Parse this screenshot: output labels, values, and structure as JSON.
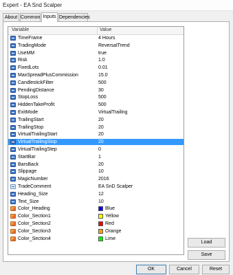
{
  "window": {
    "title": "Expert - EA Snd Scalper"
  },
  "tabs": [
    {
      "label": "About"
    },
    {
      "label": "Common"
    },
    {
      "label": "Inputs"
    },
    {
      "label": "Dependencies"
    }
  ],
  "grid": {
    "col_variable": "Variable",
    "col_value": "Value",
    "rows": [
      {
        "icon": "number-icon",
        "name": "TimeFrame",
        "value": "4 Hours"
      },
      {
        "icon": "number-icon",
        "name": "TradingMode",
        "value": "ReversalTrend"
      },
      {
        "icon": "number-icon",
        "name": "UseMM",
        "value": "true"
      },
      {
        "icon": "number-icon",
        "name": "Risk",
        "value": "1.0"
      },
      {
        "icon": "number-icon",
        "name": "FixedLots",
        "value": "0.01"
      },
      {
        "icon": "number-icon",
        "name": "MaxSpreadPlusCommission",
        "value": "15.0"
      },
      {
        "icon": "number-icon",
        "name": "CandlestickFilter",
        "value": "500"
      },
      {
        "icon": "number-icon",
        "name": "PendingDistance",
        "value": "30"
      },
      {
        "icon": "number-icon",
        "name": "StopLoss",
        "value": "500"
      },
      {
        "icon": "number-icon",
        "name": "HiddenTakeProfit",
        "value": "500"
      },
      {
        "icon": "number-icon",
        "name": "ExitMode",
        "value": "VirtualTrailing"
      },
      {
        "icon": "number-icon",
        "name": "TrailingStart",
        "value": "20"
      },
      {
        "icon": "number-icon",
        "name": "TrailingStop",
        "value": "20"
      },
      {
        "icon": "number-icon",
        "name": "VirtualTrailingStart",
        "value": "20"
      },
      {
        "icon": "number-icon",
        "name": "VirtualTrailingStop",
        "value": "20",
        "selected": true
      },
      {
        "icon": "number-icon",
        "name": "VirtualTrailingStep",
        "value": "0"
      },
      {
        "icon": "number-icon",
        "name": "StartBar",
        "value": "1"
      },
      {
        "icon": "number-icon",
        "name": "BarsBack",
        "value": "20"
      },
      {
        "icon": "number-icon",
        "name": "Slippage",
        "value": "10"
      },
      {
        "icon": "number-icon",
        "name": "MagicNumber",
        "value": "2016"
      },
      {
        "icon": "string-icon",
        "name": "TradeComment",
        "value": "EA SnD Scalper"
      },
      {
        "icon": "number-icon",
        "name": "Heading_Size",
        "value": "12"
      },
      {
        "icon": "number-icon",
        "name": "Text_Size",
        "value": "10"
      },
      {
        "icon": "color-icon",
        "name": "Color_Heading",
        "value": "Blue",
        "swatch": "#0000ff"
      },
      {
        "icon": "color-icon",
        "name": "Color_Section1",
        "value": "Yellow",
        "swatch": "#ffff00"
      },
      {
        "icon": "color-icon",
        "name": "Color_Section2",
        "value": "Red",
        "swatch": "#ff0000"
      },
      {
        "icon": "color-icon",
        "name": "Color_Section3",
        "value": "Orange",
        "swatch": "#ffa500"
      },
      {
        "icon": "color-icon",
        "name": "Color_Section4",
        "value": "Lime",
        "swatch": "#00ff00"
      }
    ]
  },
  "buttons": {
    "load": "Load",
    "save": "Save",
    "ok": "OK",
    "cancel": "Cancel",
    "reset": "Reset"
  },
  "colors": {
    "selection": "#3399ff"
  }
}
